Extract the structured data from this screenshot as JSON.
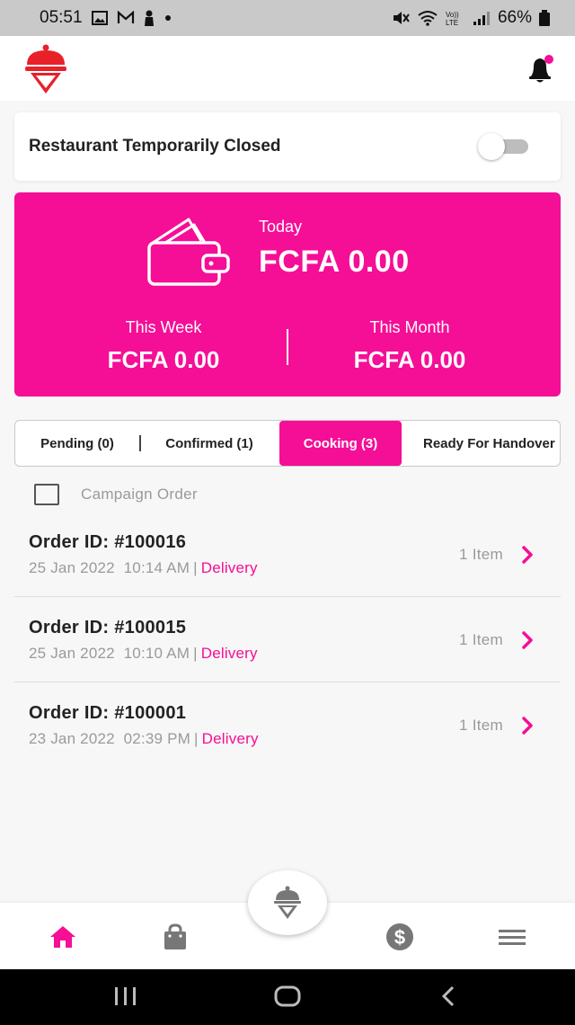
{
  "status_bar": {
    "time": "05:51",
    "battery": "66%"
  },
  "header": {
    "logo_icon": "restaurant-cloche-logo-icon",
    "notification_icon": "bell-icon",
    "notification_dot_color": "#f50e96"
  },
  "restaurant_status": {
    "label": "Restaurant Temporarily Closed",
    "toggle_on": false
  },
  "earnings": {
    "today_label": "Today",
    "today_value": "FCFA 0.00",
    "week_label": "This Week",
    "week_value": "FCFA 0.00",
    "month_label": "This Month",
    "month_value": "FCFA 0.00",
    "card_color": "#f50e96"
  },
  "tabs": [
    {
      "label": "Pending (0)",
      "active": false
    },
    {
      "label": "Confirmed (1)",
      "active": false
    },
    {
      "label": "Cooking (3)",
      "active": true
    },
    {
      "label": "Ready For Handover",
      "active": false
    }
  ],
  "campaign_filter": {
    "label": "Campaign Order",
    "checked": false
  },
  "orders": [
    {
      "id": "Order ID: #100016",
      "date": "25 Jan 2022",
      "time": "10:14 AM",
      "separator": "|",
      "type": "Delivery",
      "items": "1 Item"
    },
    {
      "id": "Order ID: #100015",
      "date": "25 Jan 2022",
      "time": "10:10 AM",
      "separator": "|",
      "type": "Delivery",
      "items": "1 Item"
    },
    {
      "id": "Order ID: #100001",
      "date": "23 Jan 2022",
      "time": "02:39 PM",
      "separator": "|",
      "type": "Delivery",
      "items": "1 Item"
    }
  ],
  "bottom_nav": {
    "items": [
      "home-icon",
      "shopping-bag-icon",
      "dollar-coin-icon",
      "menu-icon"
    ],
    "active": "home-icon",
    "center_fab_icon": "restaurant-cloche-icon",
    "accent": "#f50e96"
  },
  "system_nav": [
    "recents-icon",
    "home-circle-icon",
    "back-icon"
  ]
}
